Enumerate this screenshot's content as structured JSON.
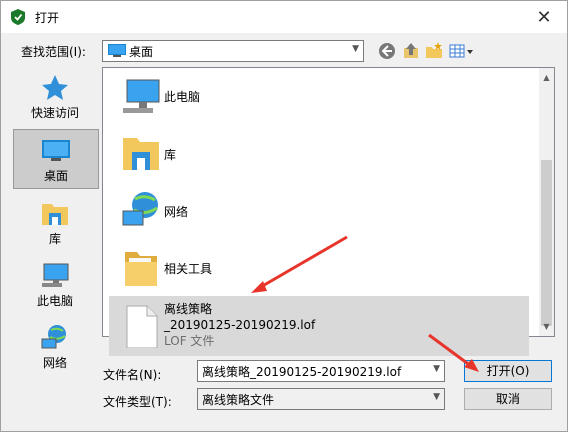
{
  "window": {
    "title": "打开",
    "close_glyph": "✕"
  },
  "look_in": {
    "label": "查找范围(I):",
    "value": "桌面"
  },
  "places": [
    {
      "label": "快速访问",
      "icon": "star-icon"
    },
    {
      "label": "桌面",
      "icon": "desktop-icon",
      "selected": true
    },
    {
      "label": "库",
      "icon": "library-icon"
    },
    {
      "label": "此电脑",
      "icon": "computer-icon"
    },
    {
      "label": "网络",
      "icon": "network-icon"
    }
  ],
  "files": [
    {
      "name": "此电脑",
      "icon": "computer-icon"
    },
    {
      "name": "库",
      "icon": "library-icon"
    },
    {
      "name": "网络",
      "icon": "network-icon"
    },
    {
      "name": "相关工具",
      "icon": "folder-icon"
    },
    {
      "name_line1": "离线策略",
      "name_line2": "_20190125-20190219.lof",
      "type": "LOF 文件",
      "icon": "file-icon",
      "selected": true
    }
  ],
  "filename": {
    "label": "文件名(N):",
    "value": "离线策略_20190125-20190219.lof"
  },
  "filetype": {
    "label": "文件类型(T):",
    "value": "离线策略文件"
  },
  "buttons": {
    "open": "打开(O)",
    "cancel": "取消"
  },
  "colors": {
    "annotation_arrow": "#e8352c",
    "accent": "#0078d7",
    "selection": "#d9d9d9"
  }
}
